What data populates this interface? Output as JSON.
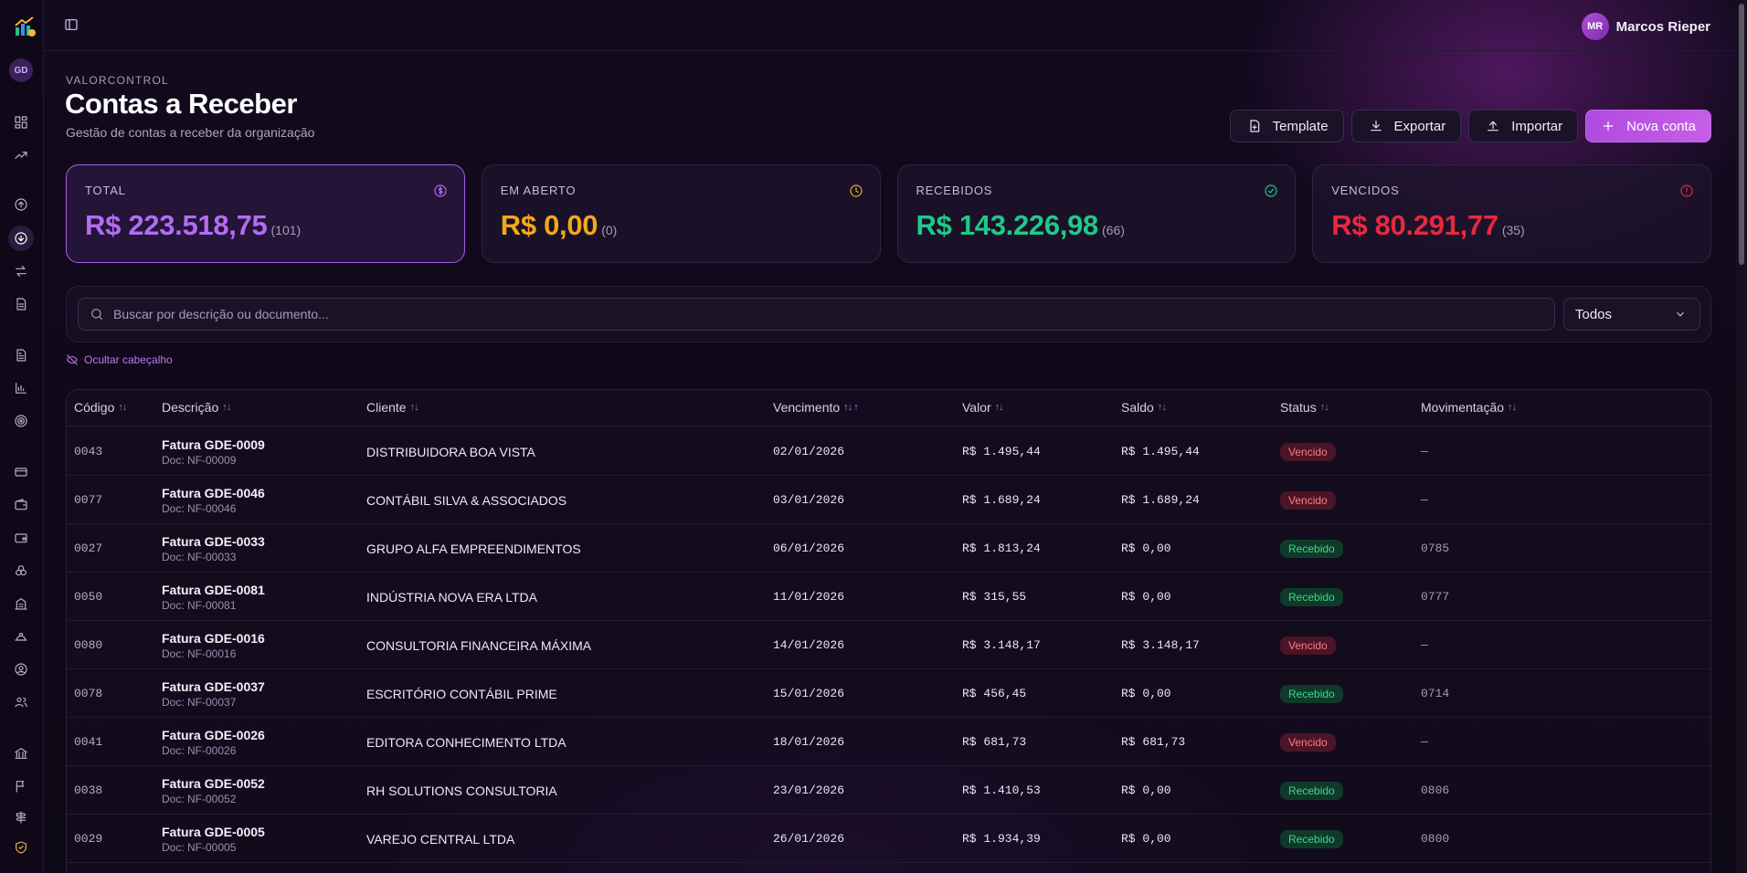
{
  "sidebar": {
    "org_initials": "GD",
    "icons": [
      "dashboard-icon",
      "trending-up-icon",
      "arrow-up-circle-icon",
      "arrow-down-circle-icon",
      "transfer-icon",
      "document-icon",
      "file-text-icon",
      "bar-chart-icon",
      "target-icon",
      "credit-card-icon",
      "wallet-icon",
      "wallet-alt-icon",
      "layers-icon",
      "building-icon",
      "hard-hat-icon",
      "user-circle-icon",
      "users-icon",
      "bank-icon",
      "flag-icon",
      "signpost-icon",
      "shield-icon"
    ]
  },
  "topbar": {
    "user_initials": "MR",
    "user_name": "Marcos Rieper"
  },
  "header": {
    "eyebrow": "VALORCONTROL",
    "title": "Contas a Receber",
    "subtitle": "Gestão de contas a receber da organização"
  },
  "actions": {
    "template": "Template",
    "export": "Exportar",
    "import": "Importar",
    "new": "Nova conta"
  },
  "stats": [
    {
      "label": "TOTAL",
      "value": "R$ 223.518,75",
      "count": "(101)",
      "color": "#b26cf2",
      "icon": "dollar-circle-icon"
    },
    {
      "label": "EM ABERTO",
      "value": "R$ 0,00",
      "count": "(0)",
      "color": "#f2a81c",
      "icon": "clock-icon"
    },
    {
      "label": "RECEBIDOS",
      "value": "R$ 143.226,98",
      "count": "(66)",
      "color": "#1fc98a",
      "icon": "check-circle-icon"
    },
    {
      "label": "VENCIDOS",
      "value": "R$ 80.291,77",
      "count": "(35)",
      "color": "#e8283f",
      "icon": "alert-circle-icon"
    }
  ],
  "filters": {
    "search_placeholder": "Buscar por descrição ou documento...",
    "status_selected": "Todos",
    "hide_header": "Ocultar cabeçalho"
  },
  "table": {
    "columns": [
      "Código",
      "Descrição",
      "Cliente",
      "Vencimento",
      "Valor",
      "Saldo",
      "Status",
      "Movimentação"
    ],
    "rows": [
      {
        "code": "0043",
        "title": "Fatura GDE-0009",
        "doc": "Doc: NF-00009",
        "client": "DISTRIBUIDORA BOA VISTA",
        "due": "02/01/2026",
        "value": "R$ 1.495,44",
        "balance": "R$ 1.495,44",
        "status": "Vencido",
        "mov": "—"
      },
      {
        "code": "0077",
        "title": "Fatura GDE-0046",
        "doc": "Doc: NF-00046",
        "client": "CONTÁBIL SILVA & ASSOCIADOS",
        "due": "03/01/2026",
        "value": "R$ 1.689,24",
        "balance": "R$ 1.689,24",
        "status": "Vencido",
        "mov": "—"
      },
      {
        "code": "0027",
        "title": "Fatura GDE-0033",
        "doc": "Doc: NF-00033",
        "client": "GRUPO ALFA EMPREENDIMENTOS",
        "due": "06/01/2026",
        "value": "R$ 1.813,24",
        "balance": "R$ 0,00",
        "status": "Recebido",
        "mov": "0785"
      },
      {
        "code": "0050",
        "title": "Fatura GDE-0081",
        "doc": "Doc: NF-00081",
        "client": "INDÚSTRIA NOVA ERA LTDA",
        "due": "11/01/2026",
        "value": "R$ 315,55",
        "balance": "R$ 0,00",
        "status": "Recebido",
        "mov": "0777"
      },
      {
        "code": "0080",
        "title": "Fatura GDE-0016",
        "doc": "Doc: NF-00016",
        "client": "CONSULTORIA FINANCEIRA MÁXIMA",
        "due": "14/01/2026",
        "value": "R$ 3.148,17",
        "balance": "R$ 3.148,17",
        "status": "Vencido",
        "mov": "—"
      },
      {
        "code": "0078",
        "title": "Fatura GDE-0037",
        "doc": "Doc: NF-00037",
        "client": "ESCRITÓRIO CONTÁBIL PRIME",
        "due": "15/01/2026",
        "value": "R$ 456,45",
        "balance": "R$ 0,00",
        "status": "Recebido",
        "mov": "0714"
      },
      {
        "code": "0041",
        "title": "Fatura GDE-0026",
        "doc": "Doc: NF-00026",
        "client": "EDITORA CONHECIMENTO LTDA",
        "due": "18/01/2026",
        "value": "R$ 681,73",
        "balance": "R$ 681,73",
        "status": "Vencido",
        "mov": "—"
      },
      {
        "code": "0038",
        "title": "Fatura GDE-0052",
        "doc": "Doc: NF-00052",
        "client": "RH SOLUTIONS CONSULTORIA",
        "due": "23/01/2026",
        "value": "R$ 1.410,53",
        "balance": "R$ 0,00",
        "status": "Recebido",
        "mov": "0806"
      },
      {
        "code": "0029",
        "title": "Fatura GDE-0005",
        "doc": "Doc: NF-00005",
        "client": "VAREJO CENTRAL LTDA",
        "due": "26/01/2026",
        "value": "R$ 1.934,39",
        "balance": "R$ 0,00",
        "status": "Recebido",
        "mov": "0800"
      }
    ]
  }
}
